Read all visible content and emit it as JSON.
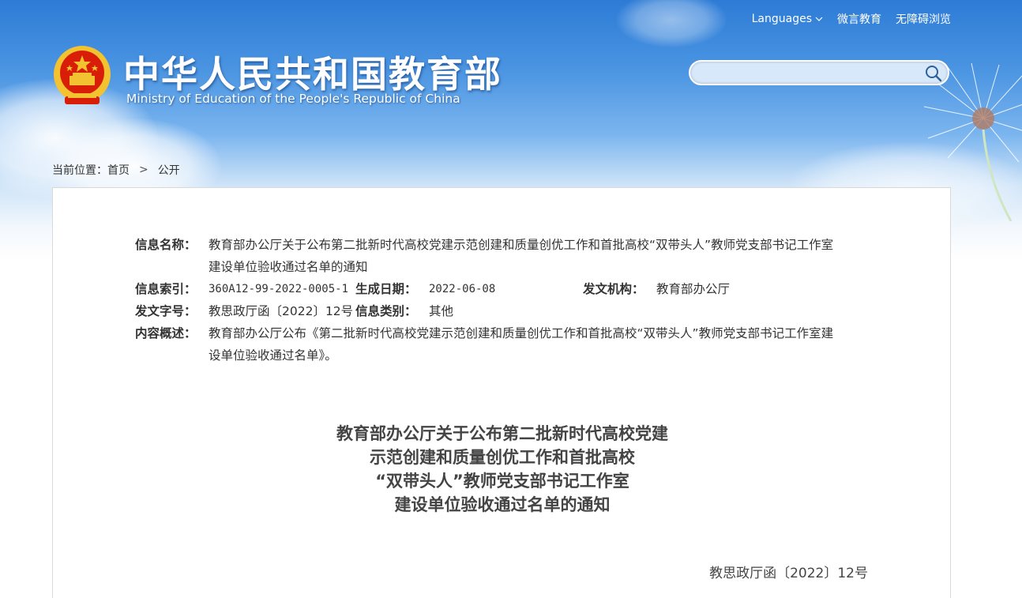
{
  "header": {
    "links": {
      "languages": "Languages",
      "weiyan": "微言教育",
      "accessible": "无障碍浏览"
    },
    "title": "中华人民共和国教育部",
    "subtitle": "Ministry of Education of the People's Republic of China",
    "search": {
      "value": "",
      "placeholder": ""
    }
  },
  "breadcrumb": {
    "prefix": "当前位置：",
    "home": "首页",
    "current": "公开"
  },
  "meta": {
    "name_label": "信息名称：",
    "name_value_line1": "教育部办公厅关于公布第二批新时代高校党建示范创建和质量创优工作和首批高校“双带头人”教师党支部书记工作室",
    "name_value_line2": "建设单位验收通过名单的通知",
    "index_label": "信息索引：",
    "index_value": "360A12-99-2022-0005-1",
    "date_label": "生成日期：",
    "date_value": "2022-06-08",
    "org_label": "发文机构：",
    "org_value": "教育部办公厅",
    "docno_label": "发文字号：",
    "docno_value": "教思政厅函〔2022〕12号",
    "category_label": "信息类别：",
    "category_value": "其他",
    "summary_label": "内容概述：",
    "summary_line1": "教育部办公厅公布《第二批新时代高校党建示范创建和质量创优工作和首批高校“双带头人”教师党支部书记工作室建",
    "summary_line2": "设单位验收通过名单》。"
  },
  "article": {
    "title_lines": [
      "教育部办公厅关于公布第二批新时代高校党建",
      "示范创建和质量创优工作和首批高校",
      "“双带头人”教师党支部书记工作室",
      "建设单位验收通过名单的通知"
    ],
    "doc_no": "教思政厅函〔2022〕12号"
  },
  "colors": {
    "header_blue": "#2d7bd6",
    "emblem_red": "#d81e06",
    "emblem_gold": "#f2c230"
  }
}
